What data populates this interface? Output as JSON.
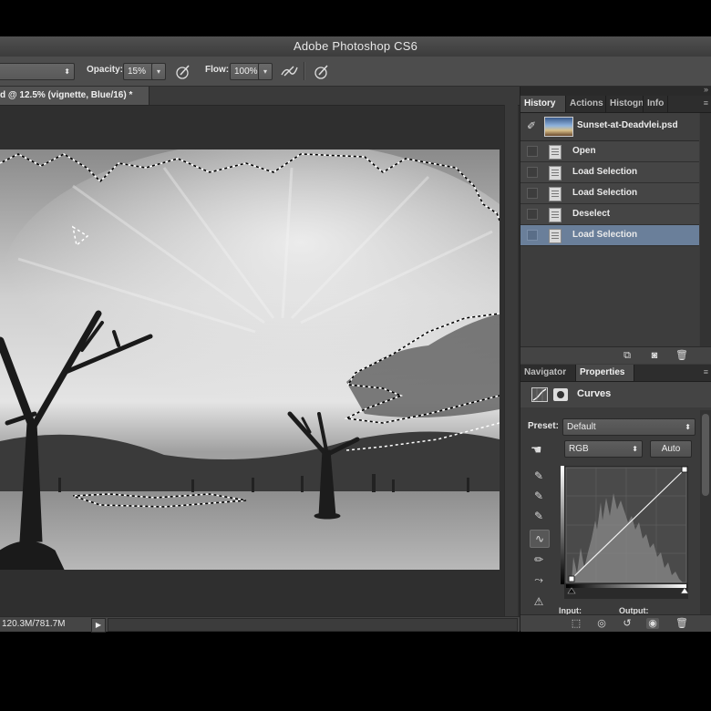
{
  "app": {
    "title": "Adobe Photoshop CS6"
  },
  "options_bar": {
    "opacity_label": "Opacity:",
    "opacity_value": "15%",
    "flow_label": "Flow:",
    "flow_value": "100%"
  },
  "document": {
    "tab_title": "d @ 12.5% (vignette, Blue/16) *",
    "status_text": "120.3M/781.7M"
  },
  "history_panel": {
    "tabs": [
      "History",
      "Actions",
      "Histogn",
      "Info"
    ],
    "active_tab": "History",
    "snapshot_name": "Sunset-at-Deadvlei.psd",
    "items": [
      {
        "label": "Open",
        "selected": false
      },
      {
        "label": "Load Selection",
        "selected": false
      },
      {
        "label": "Load Selection",
        "selected": false
      },
      {
        "label": "Deselect",
        "selected": false
      },
      {
        "label": "Load Selection",
        "selected": true
      }
    ]
  },
  "properties_panel": {
    "tabs": [
      "Navigator",
      "Properties"
    ],
    "active_tab": "Properties",
    "title": "Curves",
    "preset_label": "Preset:",
    "preset_value": "Default",
    "channel_value": "RGB",
    "auto_label": "Auto",
    "input_label": "Input:",
    "output_label": "Output:"
  },
  "colors": {
    "selection_highlight": "#6a7f9a",
    "panel_bg": "#3b3b3b",
    "canvas_bg": "#2f2f2f"
  }
}
